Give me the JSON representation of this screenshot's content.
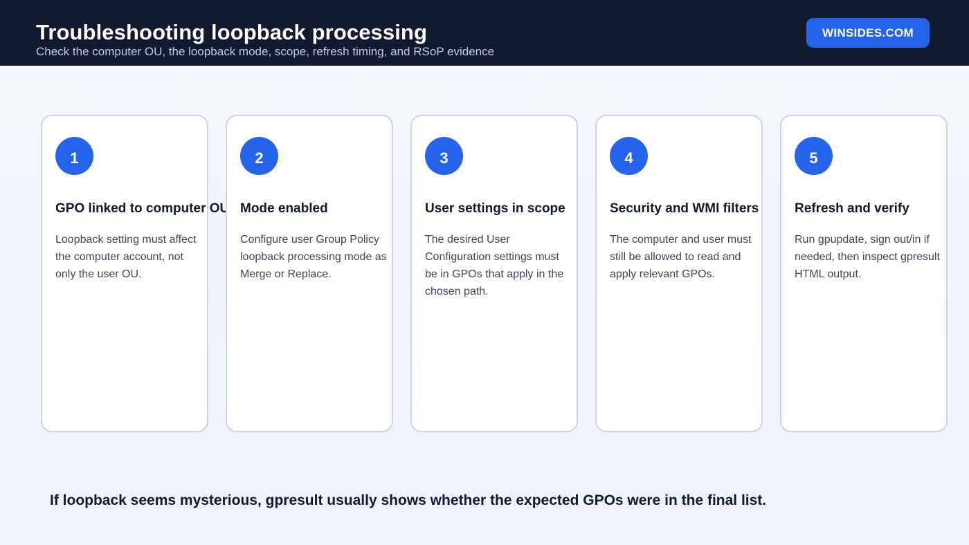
{
  "header": {
    "title": "Troubleshooting loopback processing",
    "subtitle": "Check the computer OU, the loopback mode, scope, refresh timing, and RSoP evidence",
    "brand": "WINSIDES.COM"
  },
  "steps": [
    {
      "number": "1",
      "title": "GPO linked to computer OU",
      "description": "Loopback setting must affect the computer account, not only the user OU."
    },
    {
      "number": "2",
      "title": "Mode enabled",
      "description": "Configure user Group Policy loopback processing mode as Merge or Replace."
    },
    {
      "number": "3",
      "title": "User settings in scope",
      "description": "The desired User Configuration settings must be in GPOs that apply in the chosen path."
    },
    {
      "number": "4",
      "title": "Security and WMI filters",
      "description": "The computer and user must still be allowed to read and apply relevant GPOs."
    },
    {
      "number": "5",
      "title": "Refresh and verify",
      "description": "Run gpupdate, sign out/in if needed, then inspect gpresult HTML output."
    }
  ],
  "footer": {
    "note": "If loopback seems mysterious, gpresult usually shows whether the expected GPOs were in the final list."
  },
  "colors": {
    "header_background": "#111a2e",
    "accent": "#2563eb",
    "card_border": "#cdd5e1",
    "page_background": "#f2f5fc"
  }
}
